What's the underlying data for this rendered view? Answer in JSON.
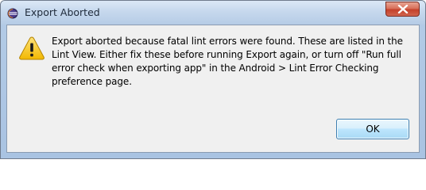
{
  "window": {
    "title": "Export Aborted"
  },
  "dialog": {
    "message": "Export aborted because fatal lint errors were found. These are listed in the Lint View. Either fix these before running Export again, or turn off \"Run full error check when exporting app\" in the Android > Lint Error Checking preference page.",
    "icon": "warning-icon"
  },
  "buttons": {
    "ok_label": "OK"
  },
  "icons": {
    "app": "eclipse-app-icon",
    "close": "close-icon"
  },
  "colors": {
    "close_button": "#c4402a",
    "warning_fill": "#f5c400",
    "dialog_background": "#f0f0f0"
  }
}
